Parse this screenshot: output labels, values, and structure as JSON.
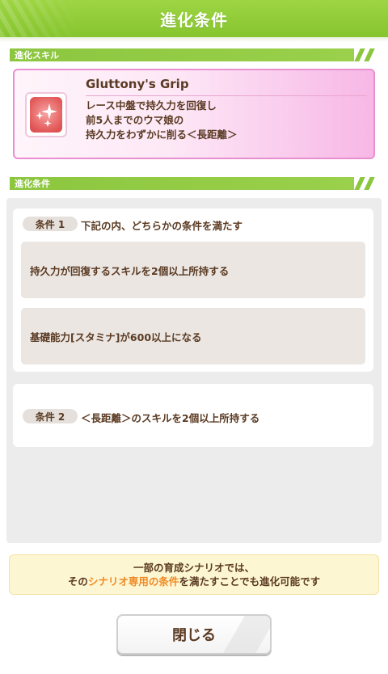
{
  "header": {
    "title": "進化条件"
  },
  "skill_section": {
    "label": "進化スキル"
  },
  "skill": {
    "name": "Gluttony's Grip",
    "description_lines": [
      "レース中盤で持久力を回復し",
      "前5人までのウマ娘の",
      "持久力をわずかに削る＜長距離＞"
    ],
    "icon": "sparkle-icon",
    "accent_color": "#e98fcf"
  },
  "conditions_section": {
    "label": "進化条件"
  },
  "conditions": [
    {
      "tag": "条件 1",
      "heading": "下記の内、どちらかの条件を満たす",
      "rows": [
        "持久力が回復するスキルを2個以上所持する",
        "基礎能力[スタミナ]が600以上になる"
      ]
    },
    {
      "tag": "条件 2",
      "heading": "＜長距離＞のスキルを2個以上所持する"
    }
  ],
  "notice": {
    "line1": "一部の育成シナリオでは、",
    "line2_pre": "その",
    "line2_highlight": "シナリオ専用の条件",
    "line2_post": "を満たすことでも進化可能です",
    "highlight_color": "#f08a24"
  },
  "close_button": {
    "label": "閉じる"
  },
  "colors": {
    "header_green": "#8cc63f",
    "text_brown": "#5a3a22"
  }
}
